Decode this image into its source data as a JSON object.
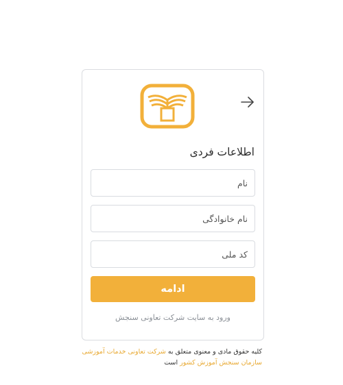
{
  "colors": {
    "accent": "#f2b03a",
    "border": "#dadce0",
    "link": "#e8a830",
    "muted_text": "#8a8f96"
  },
  "icons": {
    "logo": "book-logo-icon",
    "back": "arrow-right-icon"
  },
  "card": {
    "title": "اطلاعات فردی",
    "fields": {
      "first_name_placeholder": "نام",
      "last_name_placeholder": "نام خانوادگی",
      "national_code_placeholder": "کد ملی"
    },
    "submit_label": "ادامه",
    "site_link": "ورود به سایت شرکت تعاونی سنجش"
  },
  "footer": {
    "text_before": "کلیه حقوق مادی و معنوی متعلق به ",
    "link_text": "شرکت تعاونی خدمات آموزشی سازمان سنجش آموزش کشور",
    "text_after": " است"
  }
}
